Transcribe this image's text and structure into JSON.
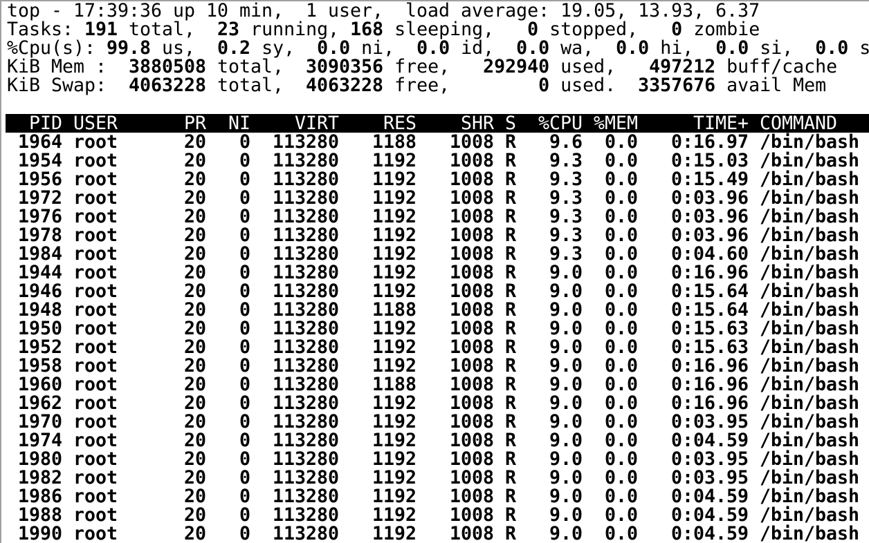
{
  "summary": [
    [
      {
        "t": "top - 17:39:36 up 10 min,  1 user,  load average: 19.05, 13.93, 6.37",
        "b": false
      }
    ],
    [
      {
        "t": "Tasks: ",
        "b": false
      },
      {
        "t": "191",
        "b": true
      },
      {
        "t": " total,  ",
        "b": false
      },
      {
        "t": "23",
        "b": true
      },
      {
        "t": " running, ",
        "b": false
      },
      {
        "t": "168",
        "b": true
      },
      {
        "t": " sleeping,   ",
        "b": false
      },
      {
        "t": "0",
        "b": true
      },
      {
        "t": " stopped,   ",
        "b": false
      },
      {
        "t": "0",
        "b": true
      },
      {
        "t": " zombie",
        "b": false
      }
    ],
    [
      {
        "t": "%Cpu(s): ",
        "b": false
      },
      {
        "t": "99.8",
        "b": true
      },
      {
        "t": " us,  ",
        "b": false
      },
      {
        "t": "0.2",
        "b": true
      },
      {
        "t": " sy,  ",
        "b": false
      },
      {
        "t": "0.0",
        "b": true
      },
      {
        "t": " ni,  ",
        "b": false
      },
      {
        "t": "0.0",
        "b": true
      },
      {
        "t": " id,  ",
        "b": false
      },
      {
        "t": "0.0",
        "b": true
      },
      {
        "t": " wa,  ",
        "b": false
      },
      {
        "t": "0.0",
        "b": true
      },
      {
        "t": " hi,  ",
        "b": false
      },
      {
        "t": "0.0",
        "b": true
      },
      {
        "t": " si,  ",
        "b": false
      },
      {
        "t": "0.0",
        "b": true
      },
      {
        "t": " s",
        "b": false
      }
    ],
    [
      {
        "t": "KiB Mem :  ",
        "b": false
      },
      {
        "t": "3880508",
        "b": true
      },
      {
        "t": " total,  ",
        "b": false
      },
      {
        "t": "3090356",
        "b": true
      },
      {
        "t": " free,   ",
        "b": false
      },
      {
        "t": "292940",
        "b": true
      },
      {
        "t": " used,   ",
        "b": false
      },
      {
        "t": "497212",
        "b": true
      },
      {
        "t": " buff/cache",
        "b": false
      }
    ],
    [
      {
        "t": "KiB Swap:  ",
        "b": false
      },
      {
        "t": "4063228",
        "b": true
      },
      {
        "t": " total,  ",
        "b": false
      },
      {
        "t": "4063228",
        "b": true
      },
      {
        "t": " free,        ",
        "b": false
      },
      {
        "t": "0",
        "b": true
      },
      {
        "t": " used.  ",
        "b": false
      },
      {
        "t": "3357676",
        "b": true
      },
      {
        "t": " avail Mem",
        "b": false
      }
    ]
  ],
  "columns": [
    "PID",
    "USER",
    "PR",
    "NI",
    "VIRT",
    "RES",
    "SHR",
    "S",
    "%CPU",
    "%MEM",
    "TIME+",
    "COMMAND"
  ],
  "rows": [
    [
      "1964",
      "root",
      "20",
      "0",
      "113280",
      "1188",
      "1008",
      "R",
      "9.6",
      "0.0",
      "0:16.97",
      "/bin/bash"
    ],
    [
      "1954",
      "root",
      "20",
      "0",
      "113280",
      "1192",
      "1008",
      "R",
      "9.3",
      "0.0",
      "0:15.03",
      "/bin/bash"
    ],
    [
      "1956",
      "root",
      "20",
      "0",
      "113280",
      "1192",
      "1008",
      "R",
      "9.3",
      "0.0",
      "0:15.49",
      "/bin/bash"
    ],
    [
      "1972",
      "root",
      "20",
      "0",
      "113280",
      "1192",
      "1008",
      "R",
      "9.3",
      "0.0",
      "0:03.96",
      "/bin/bash"
    ],
    [
      "1976",
      "root",
      "20",
      "0",
      "113280",
      "1192",
      "1008",
      "R",
      "9.3",
      "0.0",
      "0:03.96",
      "/bin/bash"
    ],
    [
      "1978",
      "root",
      "20",
      "0",
      "113280",
      "1192",
      "1008",
      "R",
      "9.3",
      "0.0",
      "0:03.96",
      "/bin/bash"
    ],
    [
      "1984",
      "root",
      "20",
      "0",
      "113280",
      "1192",
      "1008",
      "R",
      "9.3",
      "0.0",
      "0:04.60",
      "/bin/bash"
    ],
    [
      "1944",
      "root",
      "20",
      "0",
      "113280",
      "1192",
      "1008",
      "R",
      "9.0",
      "0.0",
      "0:16.96",
      "/bin/bash"
    ],
    [
      "1946",
      "root",
      "20",
      "0",
      "113280",
      "1192",
      "1008",
      "R",
      "9.0",
      "0.0",
      "0:15.64",
      "/bin/bash"
    ],
    [
      "1948",
      "root",
      "20",
      "0",
      "113280",
      "1188",
      "1008",
      "R",
      "9.0",
      "0.0",
      "0:15.64",
      "/bin/bash"
    ],
    [
      "1950",
      "root",
      "20",
      "0",
      "113280",
      "1192",
      "1008",
      "R",
      "9.0",
      "0.0",
      "0:15.63",
      "/bin/bash"
    ],
    [
      "1952",
      "root",
      "20",
      "0",
      "113280",
      "1192",
      "1008",
      "R",
      "9.0",
      "0.0",
      "0:15.63",
      "/bin/bash"
    ],
    [
      "1958",
      "root",
      "20",
      "0",
      "113280",
      "1192",
      "1008",
      "R",
      "9.0",
      "0.0",
      "0:16.96",
      "/bin/bash"
    ],
    [
      "1960",
      "root",
      "20",
      "0",
      "113280",
      "1188",
      "1008",
      "R",
      "9.0",
      "0.0",
      "0:16.96",
      "/bin/bash"
    ],
    [
      "1962",
      "root",
      "20",
      "0",
      "113280",
      "1192",
      "1008",
      "R",
      "9.0",
      "0.0",
      "0:16.96",
      "/bin/bash"
    ],
    [
      "1970",
      "root",
      "20",
      "0",
      "113280",
      "1192",
      "1008",
      "R",
      "9.0",
      "0.0",
      "0:03.95",
      "/bin/bash"
    ],
    [
      "1974",
      "root",
      "20",
      "0",
      "113280",
      "1192",
      "1008",
      "R",
      "9.0",
      "0.0",
      "0:04.59",
      "/bin/bash"
    ],
    [
      "1980",
      "root",
      "20",
      "0",
      "113280",
      "1192",
      "1008",
      "R",
      "9.0",
      "0.0",
      "0:03.95",
      "/bin/bash"
    ],
    [
      "1982",
      "root",
      "20",
      "0",
      "113280",
      "1192",
      "1008",
      "R",
      "9.0",
      "0.0",
      "0:03.95",
      "/bin/bash"
    ],
    [
      "1986",
      "root",
      "20",
      "0",
      "113280",
      "1192",
      "1008",
      "R",
      "9.0",
      "0.0",
      "0:04.59",
      "/bin/bash"
    ],
    [
      "1988",
      "root",
      "20",
      "0",
      "113280",
      "1192",
      "1008",
      "R",
      "9.0",
      "0.0",
      "0:04.59",
      "/bin/bash"
    ],
    [
      "1990",
      "root",
      "20",
      "0",
      "113280",
      "1192",
      "1008",
      "R",
      "9.0",
      "0.0",
      "0:04.59",
      "/bin/bash"
    ]
  ],
  "colors": {
    "background": "#ffffff",
    "text": "#000000",
    "header_bar": "#000000",
    "header_text": "#ffffff"
  }
}
